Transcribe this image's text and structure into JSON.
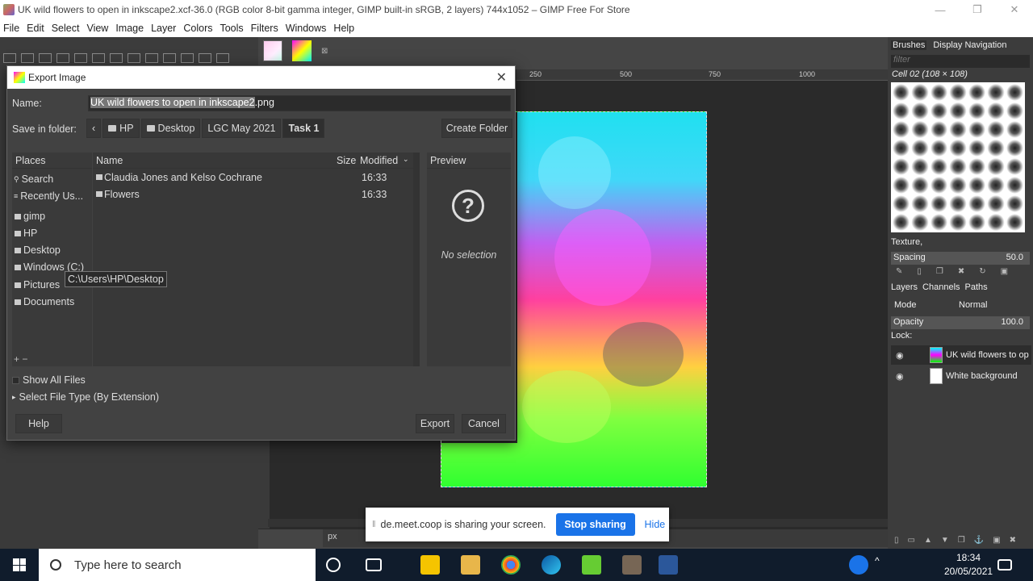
{
  "window": {
    "title": "UK wild flowers to open in inkscape2.xcf-36.0 (RGB color 8-bit gamma integer, GIMP built-in sRGB, 2 layers) 744x1052 – GIMP Free For Store",
    "minimize": "—",
    "restore": "❐",
    "close": "✕"
  },
  "menu": [
    "File",
    "Edit",
    "Select",
    "View",
    "Image",
    "Layer",
    "Colors",
    "Tools",
    "Filters",
    "Windows",
    "Help"
  ],
  "canvas": {
    "ruler_ticks": [
      "250",
      "500",
      "750",
      "1000"
    ],
    "unit": "px"
  },
  "dock": {
    "tabs": [
      "Brushes",
      "Display Navigation"
    ],
    "filter_placeholder": "filter",
    "brush_name": "Cell 02 (108 × 108)",
    "texture": "Texture,",
    "spacing_label": "Spacing",
    "spacing_value": "50.0",
    "layer_tabs": [
      "Layers",
      "Channels",
      "Paths"
    ],
    "mode_label": "Mode",
    "mode_value": "Normal",
    "opacity_label": "Opacity",
    "opacity_value": "100.0",
    "lock_label": "Lock:",
    "layers": [
      {
        "name": "UK wild flowers to op",
        "visible": true
      },
      {
        "name": "White background",
        "visible": true
      }
    ]
  },
  "dialog": {
    "title": "Export Image",
    "name_label": "Name:",
    "name_selected": "UK wild flowers to open in inkscape2",
    "name_ext": ".png",
    "folder_label": "Save in folder:",
    "crumbs": [
      "HP",
      "Desktop",
      "LGC May 2021",
      "Task 1"
    ],
    "create_folder": "Create Folder",
    "places_header": "Places",
    "places": [
      "Search",
      "Recently Us...",
      "gimp",
      "HP",
      "Desktop",
      "Windows (C:)",
      "Pictures",
      "Documents"
    ],
    "files_headers": {
      "name": "Name",
      "size": "Size",
      "modified": "Modified"
    },
    "files": [
      {
        "name": "Claudia Jones and Kelso Cochrane",
        "modified": "16:33"
      },
      {
        "name": "Flowers",
        "modified": "16:33"
      }
    ],
    "preview_header": "Preview",
    "no_selection": "No selection",
    "tooltip": "C:\\Users\\HP\\Desktop",
    "show_all": "Show All Files",
    "file_type": "Select File Type (By Extension)",
    "help": "Help",
    "export": "Export",
    "cancel": "Cancel"
  },
  "share": {
    "message": "de.meet.coop is sharing your screen.",
    "stop": "Stop sharing",
    "hide": "Hide"
  },
  "taskbar": {
    "search_placeholder": "Type here to search",
    "time": "18:34",
    "date": "20/05/2021"
  }
}
